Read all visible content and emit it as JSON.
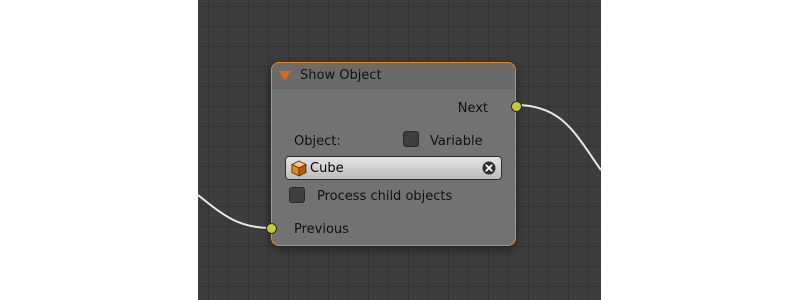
{
  "node": {
    "title": "Show Object",
    "outputs": {
      "next_label": "Next"
    },
    "object_label": "Object:",
    "variable_label": "Variable",
    "variable_checked": false,
    "object_field": {
      "value": "Cube"
    },
    "process_child_label": "Process child objects",
    "process_child_checked": false,
    "inputs": {
      "previous_label": "Previous"
    }
  },
  "colors": {
    "canvas_background": "#3d3d3d",
    "node_body": "#727272",
    "selected_outline": "#e68a1c",
    "socket": "#c8c83a",
    "link": "#e8e8e8",
    "collapse_arrow": "#e0651b"
  },
  "icons": {
    "collapse": "triangle-down-icon",
    "object": "cube-icon",
    "clear": "x-circle-icon"
  }
}
